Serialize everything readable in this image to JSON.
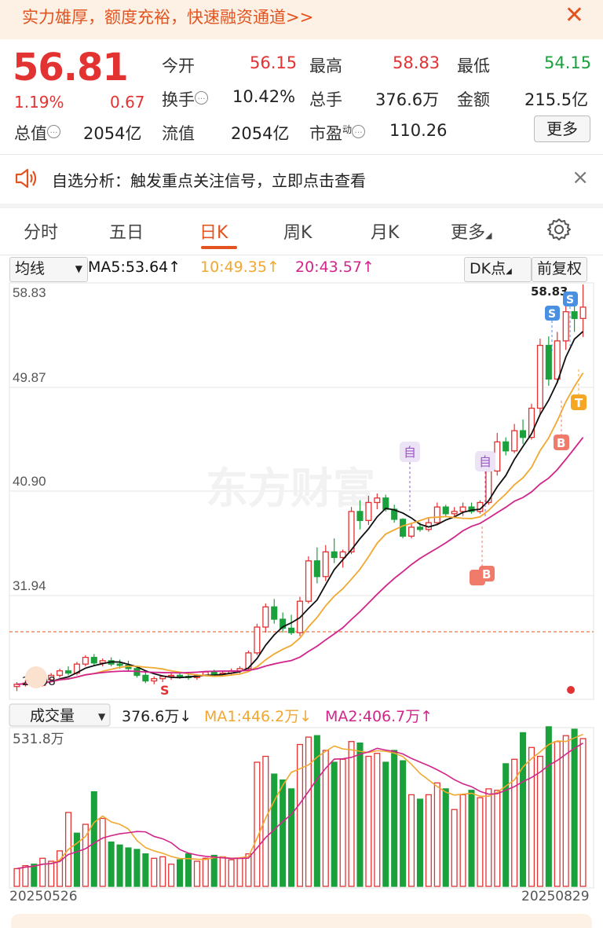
{
  "banner": {
    "text": "实力雄厚，额度充裕，快速融资通道>>",
    "close": "✕"
  },
  "quote": {
    "price": "56.81",
    "pct": "1.19%",
    "change": "0.67",
    "open_label": "今开",
    "open": "56.15",
    "high_label": "最高",
    "high": "58.83",
    "low_label": "最低",
    "low": "54.15",
    "turnover_label": "换手",
    "turnover": "10.42%",
    "volume_label": "总手",
    "volume": "376.6万",
    "amount_label": "金额",
    "amount": "215.5亿",
    "mktcap_label": "总值",
    "mktcap": "2054亿",
    "float_label": "流值",
    "float_cap": "2054亿",
    "pe_label": "市盈",
    "pe_sup": "动",
    "pe": "110.26",
    "more": "更多"
  },
  "notice": {
    "text": "自选分析：触发重点关注信号，立即点击查看",
    "close": "×"
  },
  "tabs": [
    {
      "label": "分时"
    },
    {
      "label": "五日"
    },
    {
      "label": "日K"
    },
    {
      "label": "周K"
    },
    {
      "label": "月K"
    },
    {
      "label": "更多"
    }
  ],
  "active_tab": "日K",
  "controls": {
    "ma_select": "均线",
    "ma5": "MA5:53.64↑",
    "ma10": "10:49.35↑",
    "ma20": "20:43.57↑",
    "dk": "DK点",
    "adjust": "前复权"
  },
  "price_axis": [
    "58.83",
    "49.87",
    "40.90",
    "31.94"
  ],
  "annotations": {
    "high_label": "58.83",
    "low_label": "22.98",
    "signal_self": "自",
    "signal_s": "S",
    "signal_b": "B",
    "signal_t": "T"
  },
  "watermark": "东方财富",
  "volume_panel": {
    "select": "成交量",
    "vol": "376.6万↓",
    "ma1": "MA1:446.2万↓",
    "ma2": "MA2:406.7万↑",
    "max_label": "531.8万",
    "start_date": "20250526",
    "end_date": "20250829"
  },
  "colors": {
    "up": "#e33232",
    "down": "#1aa13c",
    "ma5": "#111111",
    "ma10": "#f0a830",
    "ma20": "#d1258a",
    "accent": "#e2541f"
  },
  "chart_data": {
    "type": "candlestick",
    "ylim": [
      22.0,
      58.83
    ],
    "candles": [
      [
        23.0,
        23.4,
        22.6,
        23.2
      ],
      [
        23.2,
        23.6,
        23.0,
        23.3
      ],
      [
        23.3,
        23.5,
        22.98,
        23.1
      ],
      [
        23.1,
        23.8,
        23.0,
        23.6
      ],
      [
        23.6,
        24.2,
        23.4,
        24.0
      ],
      [
        24.0,
        24.6,
        23.8,
        24.4
      ],
      [
        24.4,
        24.8,
        24.0,
        24.2
      ],
      [
        24.2,
        25.2,
        24.0,
        25.0
      ],
      [
        25.0,
        25.8,
        24.8,
        25.6
      ],
      [
        25.6,
        25.9,
        24.9,
        25.1
      ],
      [
        25.1,
        25.5,
        24.8,
        25.3
      ],
      [
        25.3,
        25.6,
        24.8,
        25.0
      ],
      [
        25.0,
        25.4,
        24.6,
        24.9
      ],
      [
        24.9,
        25.3,
        24.4,
        24.6
      ],
      [
        24.6,
        24.8,
        23.8,
        24.0
      ],
      [
        24.0,
        24.3,
        23.3,
        23.5
      ],
      [
        23.5,
        23.9,
        23.2,
        23.7
      ],
      [
        23.7,
        24.0,
        23.4,
        23.9
      ],
      [
        23.9,
        24.2,
        23.6,
        24.0
      ],
      [
        24.0,
        24.3,
        23.7,
        23.9
      ],
      [
        23.9,
        24.1,
        23.6,
        23.8
      ],
      [
        23.8,
        24.1,
        23.6,
        24.0
      ],
      [
        24.0,
        24.4,
        23.9,
        24.3
      ],
      [
        24.3,
        24.5,
        24.0,
        24.1
      ],
      [
        24.1,
        24.4,
        23.9,
        24.2
      ],
      [
        24.2,
        24.6,
        24.0,
        24.4
      ],
      [
        24.4,
        24.8,
        24.2,
        24.6
      ],
      [
        24.6,
        26.2,
        24.5,
        26.0
      ],
      [
        26.0,
        28.6,
        25.8,
        28.3
      ],
      [
        28.3,
        30.4,
        27.8,
        30.1
      ],
      [
        30.1,
        30.8,
        28.6,
        29.0
      ],
      [
        29.0,
        29.6,
        27.8,
        28.2
      ],
      [
        28.2,
        29.4,
        27.6,
        27.8
      ],
      [
        27.8,
        31.0,
        27.5,
        30.6
      ],
      [
        30.6,
        34.6,
        30.4,
        34.2
      ],
      [
        34.2,
        35.4,
        32.2,
        32.8
      ],
      [
        32.8,
        35.6,
        32.4,
        35.0
      ],
      [
        35.0,
        36.2,
        34.0,
        34.5
      ],
      [
        34.5,
        35.2,
        33.6,
        35.0
      ],
      [
        35.0,
        39.0,
        34.8,
        38.6
      ],
      [
        38.6,
        39.6,
        37.0,
        37.8
      ],
      [
        37.8,
        40.0,
        37.4,
        39.4
      ],
      [
        39.4,
        40.2,
        38.8,
        39.8
      ],
      [
        39.8,
        40.1,
        38.6,
        38.8
      ],
      [
        38.8,
        39.2,
        37.6,
        37.9
      ],
      [
        37.9,
        38.0,
        36.2,
        36.4
      ],
      [
        36.4,
        37.6,
        36.2,
        37.2
      ],
      [
        37.2,
        37.6,
        36.8,
        37.0
      ],
      [
        37.0,
        38.0,
        36.8,
        37.6
      ],
      [
        37.6,
        39.4,
        37.4,
        39.0
      ],
      [
        39.0,
        39.2,
        38.2,
        38.4
      ],
      [
        38.4,
        39.0,
        38.0,
        38.6
      ],
      [
        38.6,
        39.4,
        38.2,
        39.0
      ],
      [
        39.0,
        39.4,
        38.4,
        38.6
      ],
      [
        38.6,
        39.6,
        38.4,
        39.4
      ],
      [
        39.4,
        42.6,
        39.2,
        42.2
      ],
      [
        42.2,
        45.6,
        41.8,
        44.8
      ],
      [
        44.8,
        45.2,
        43.6,
        44.0
      ],
      [
        44.0,
        46.4,
        43.8,
        45.8
      ],
      [
        45.8,
        46.8,
        44.6,
        45.2
      ],
      [
        45.2,
        48.2,
        45.0,
        47.8
      ],
      [
        47.8,
        54.0,
        47.2,
        53.4
      ],
      [
        53.4,
        54.2,
        49.8,
        50.4
      ],
      [
        50.4,
        54.6,
        50.0,
        53.8
      ],
      [
        53.8,
        57.4,
        53.0,
        56.4
      ],
      [
        56.4,
        57.6,
        54.6,
        55.8
      ],
      [
        55.8,
        58.83,
        54.15,
        56.81
      ]
    ],
    "volume_max": 531.8,
    "volumes": [
      60,
      70,
      75,
      95,
      85,
      120,
      250,
      180,
      210,
      320,
      230,
      150,
      140,
      130,
      125,
      110,
      95,
      100,
      75,
      90,
      110,
      85,
      95,
      105,
      100,
      90,
      95,
      110,
      420,
      440,
      380,
      360,
      330,
      480,
      505,
      510,
      460,
      420,
      430,
      490,
      485,
      440,
      450,
      420,
      460,
      425,
      310,
      295,
      310,
      350,
      330,
      260,
      310,
      325,
      300,
      330,
      325,
      415,
      430,
      520,
      470,
      440,
      540,
      490,
      510,
      531.8,
      500
    ],
    "volume_up": [
      true,
      true,
      false,
      true,
      true,
      true,
      true,
      false,
      true,
      false,
      true,
      false,
      false,
      false,
      false,
      false,
      true,
      true,
      true,
      false,
      false,
      true,
      true,
      false,
      true,
      true,
      true,
      true,
      true,
      true,
      false,
      false,
      false,
      true,
      true,
      false,
      true,
      false,
      true,
      true,
      false,
      true,
      true,
      false,
      false,
      false,
      true,
      false,
      true,
      true,
      false,
      true,
      true,
      false,
      true,
      true,
      true,
      false,
      true,
      false,
      true,
      true,
      false,
      true,
      true,
      false,
      true
    ],
    "ma_lines": [
      "MA5",
      "MA10",
      "MA20"
    ],
    "vol_ma": [
      "MA1",
      "MA2"
    ]
  }
}
